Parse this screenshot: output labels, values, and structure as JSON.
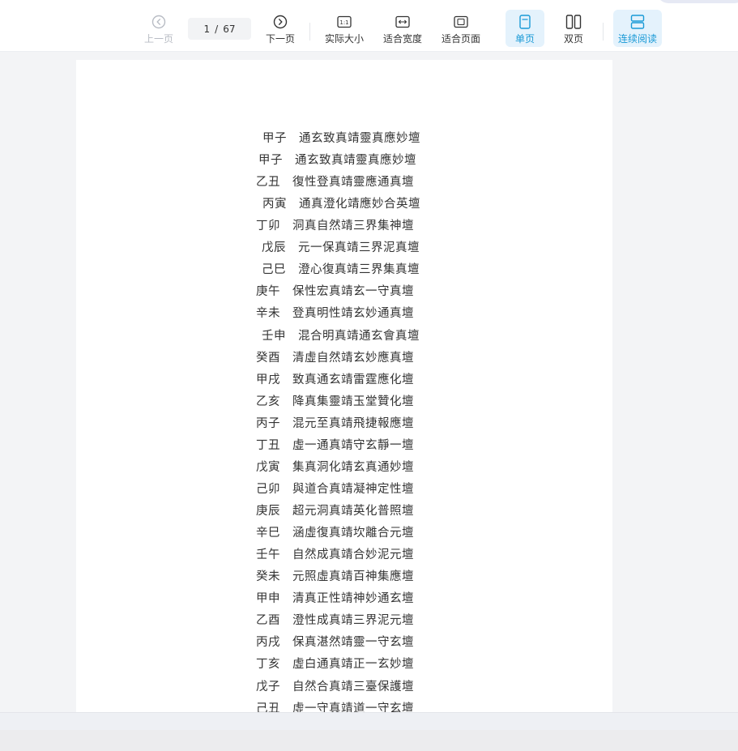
{
  "toolbar": {
    "prev_label": "上一页",
    "current_page": "1",
    "page_separator": "/",
    "total_pages": "67",
    "next_label": "下一页",
    "actual_size_label": "实际大小",
    "fit_width_label": "适合宽度",
    "fit_page_label": "适合页面",
    "single_page_label": "单页",
    "double_page_label": "双页",
    "continuous_label": "连续阅读",
    "actual_size_icon_text": "1:1"
  },
  "document": {
    "lines": [
      "甲子　通玄致真靖靈真應妙壇",
      "甲子　通玄致真靖靈真應妙壇",
      "乙丑　復性登真靖靈應通真壇",
      "丙寅　通真澄化靖應妙合英壇",
      "丁卯　洞真自然靖三界集神壇",
      "戊辰　元一保真靖三界泥真壇",
      "己巳　澄心復真靖三界集真壇",
      "庚午　保性宏真靖玄一守真壇",
      "辛未　登真明性靖玄妙通真壇",
      "壬申　混合明真靖通玄會真壇",
      "癸酉　清虛自然靖玄妙應真壇",
      "甲戌　致真通玄靖雷霆應化壇",
      "乙亥　降真集靈靖玉堂贊化壇",
      "丙子　混元至真靖飛捷報應壇",
      "丁丑　虛一通真靖守玄靜一壇",
      "戊寅　集真洞化靖玄真通妙壇",
      "己卯　與道合真靖凝神定性壇",
      "庚辰　超元洞真靖英化普照壇",
      "辛巳　涵虛復真靖坎離合元壇",
      "壬午　自然成真靖合妙泥元壇",
      "癸未　元照虛真靖百神集應壇",
      "甲申　清真正性靖神妙通玄壇",
      "乙酉　澄性成真靖三界泥元壇",
      "丙戌　保真湛然靖靈一守玄壇",
      "丁亥　虛白通真靖正一玄妙壇",
      "戊子　自然合真靖三臺保護壇",
      "己丑　虛一守真靖道一守玄壇"
    ]
  },
  "colors": {
    "accent": "#1a9ad6",
    "active_bg": "#e4f2fc",
    "disabled": "#b8bcc4",
    "text": "#333333"
  }
}
